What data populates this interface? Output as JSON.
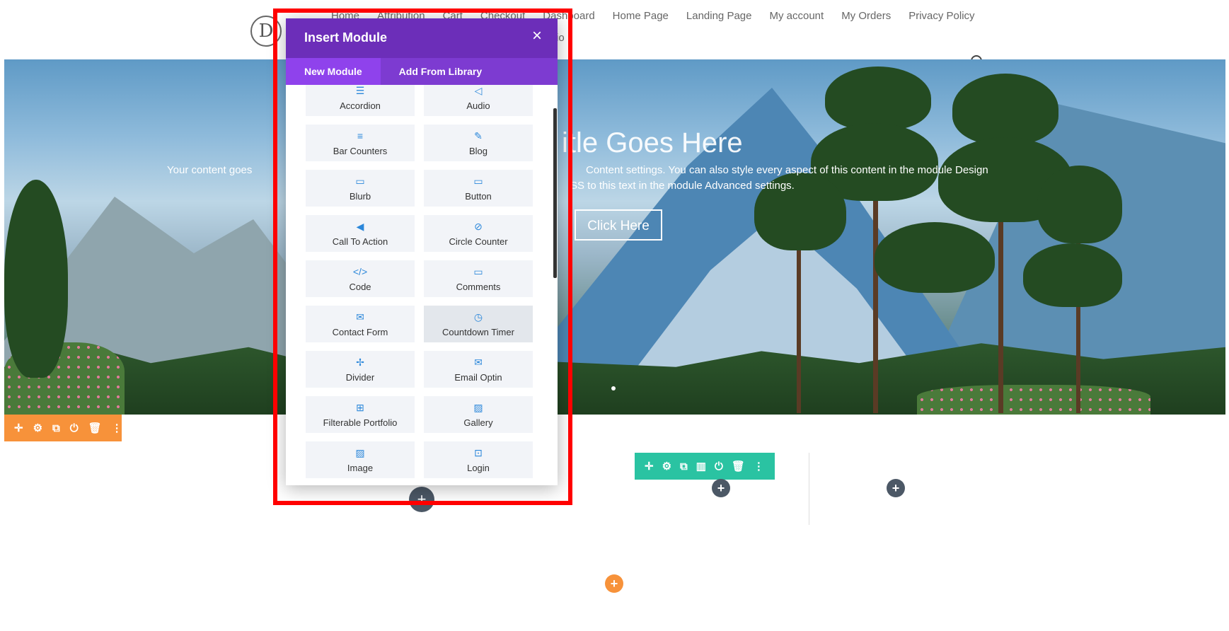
{
  "nav": {
    "logo": "D",
    "items": [
      "Home",
      "Attribution",
      "Cart",
      "Checkout",
      "Dashboard",
      "Home Page",
      "Landing Page",
      "My account",
      "My Orders",
      "Privacy Policy"
    ],
    "sub_item": "io"
  },
  "hero": {
    "title": "itle Goes Here",
    "text_left": "Your content goes",
    "text_right": "Content settings. You can also style every aspect of this content in the module Design",
    "text_line2": "SS to this text in the module Advanced settings.",
    "button": "Click Here"
  },
  "modal": {
    "title": "Insert Module",
    "close": "×",
    "tabs": [
      "New Module",
      "Add From Library"
    ],
    "modules": [
      {
        "label": "Accordion",
        "icon": "☰"
      },
      {
        "label": "Audio",
        "icon": "◁"
      },
      {
        "label": "Bar Counters",
        "icon": "≡"
      },
      {
        "label": "Blog",
        "icon": "✎"
      },
      {
        "label": "Blurb",
        "icon": "▭"
      },
      {
        "label": "Button",
        "icon": "▭"
      },
      {
        "label": "Call To Action",
        "icon": "◀"
      },
      {
        "label": "Circle Counter",
        "icon": "⊘"
      },
      {
        "label": "Code",
        "icon": "</>"
      },
      {
        "label": "Comments",
        "icon": "▭"
      },
      {
        "label": "Contact Form",
        "icon": "✉"
      },
      {
        "label": "Countdown Timer",
        "icon": "◷"
      },
      {
        "label": "Divider",
        "icon": "✢"
      },
      {
        "label": "Email Optin",
        "icon": "✉"
      },
      {
        "label": "Filterable Portfolio",
        "icon": "⊞"
      },
      {
        "label": "Gallery",
        "icon": "▨"
      },
      {
        "label": "Image",
        "icon": "▨"
      },
      {
        "label": "Login",
        "icon": "⊡"
      }
    ]
  },
  "colors": {
    "modal_header": "#6c2eb9",
    "modal_tabs": "#7d3bd1",
    "section_toolbar": "#f7923a",
    "row_toolbar": "#2ac3a2",
    "module_icon": "#2b87da",
    "highlight_frame": "#ff0000"
  },
  "toolbars": {
    "section": [
      "✛",
      "⚙",
      "⧉",
      "⏻",
      "🗑",
      "⋮"
    ],
    "row": [
      "✛",
      "⚙",
      "⧉",
      "▥",
      "⏻",
      "🗑",
      "⋮"
    ]
  },
  "add_buttons": [
    "+",
    "+",
    "+",
    "+"
  ]
}
